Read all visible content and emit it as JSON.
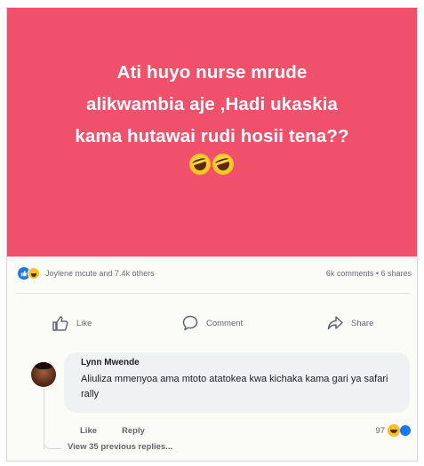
{
  "post": {
    "text_lines": [
      "Ati huyo nurse mrude",
      "alikwambia aje ,Hadi ukaskia",
      "kama hutawai rudi hosii tena??"
    ],
    "background_color": "#f0506a",
    "emoji": [
      "laughing-tears-emoji",
      "laughing-tears-emoji"
    ]
  },
  "reactions": {
    "summary": "Joylene mcute and 7.4k others",
    "counts": "6k comments • 6 shares",
    "icons": [
      "like-reaction-icon",
      "haha-reaction-icon"
    ]
  },
  "actions": {
    "like": "Like",
    "comment": "Comment",
    "share": "Share"
  },
  "comment": {
    "author": "Lynn Mwende",
    "text": "Aliuliza mmenyoa ama mtoto atatokea kwa kichaka kama gari ya safari rally",
    "like_label": "Like",
    "reply_label": "Reply",
    "reaction_count": "97"
  },
  "thread": {
    "view_replies": "View 35 previous replies..."
  }
}
